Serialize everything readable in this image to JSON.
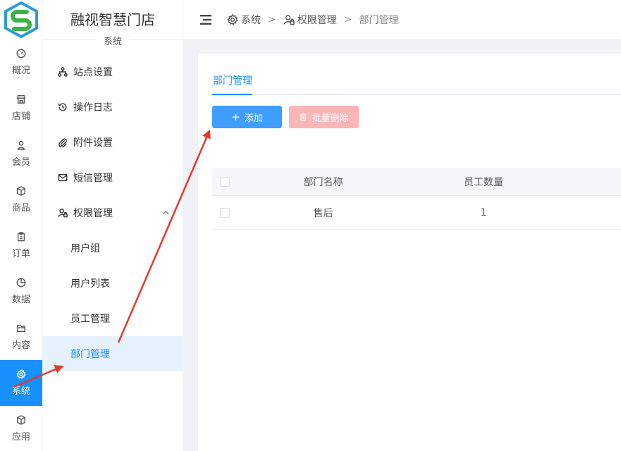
{
  "rail": {
    "items": [
      {
        "label": "概况",
        "icon": "dashboard-icon"
      },
      {
        "label": "店铺",
        "icon": "shop-icon"
      },
      {
        "label": "会员",
        "icon": "user-icon"
      },
      {
        "label": "商品",
        "icon": "box-icon"
      },
      {
        "label": "订单",
        "icon": "clipboard-icon"
      },
      {
        "label": "数据",
        "icon": "pie-chart-icon"
      },
      {
        "label": "内容",
        "icon": "folder-icon"
      },
      {
        "label": "系统",
        "icon": "gear-icon",
        "active": true
      },
      {
        "label": "应用",
        "icon": "cube-icon"
      }
    ]
  },
  "sidebar": {
    "brand": "融视智慧门店",
    "section": "系统",
    "menu": [
      {
        "label": "站点设置",
        "icon": "sitemap-icon"
      },
      {
        "label": "操作日志",
        "icon": "history-icon"
      },
      {
        "label": "附件设置",
        "icon": "paperclip-icon"
      },
      {
        "label": "短信管理",
        "icon": "mail-icon"
      },
      {
        "label": "权限管理",
        "icon": "user-lock-icon",
        "expanded": true
      }
    ],
    "submenu": [
      {
        "label": "用户组"
      },
      {
        "label": "用户列表"
      },
      {
        "label": "员工管理"
      },
      {
        "label": "部门管理",
        "active": true
      }
    ]
  },
  "header": {
    "breadcrumb": [
      {
        "label": "系统",
        "icon": "gear-icon"
      },
      {
        "label": "权限管理",
        "icon": "user-lock-icon"
      },
      {
        "label": "部门管理"
      }
    ],
    "separator": ">"
  },
  "main": {
    "tab": "部门管理",
    "add_button": "添加",
    "batch_delete_button": "批量删除",
    "table": {
      "columns": [
        "部门名称",
        "员工数量"
      ],
      "rows": [
        {
          "name": "售后",
          "count": "1"
        }
      ]
    }
  },
  "colors": {
    "primary": "#1890ff",
    "button_primary": "#409eff",
    "button_danger_disabled": "#fab6b6",
    "annotation_arrow": "#e8382c"
  }
}
